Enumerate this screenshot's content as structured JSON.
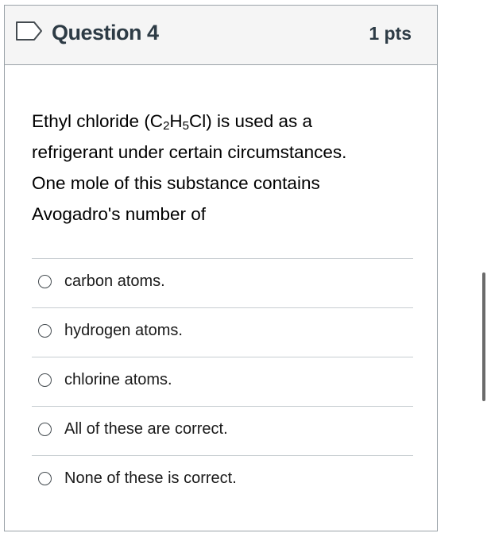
{
  "header": {
    "title": "Question 4",
    "points": "1 pts",
    "flag_icon": "flag-outline-icon"
  },
  "question": {
    "line1_pre": "Ethyl chloride (C",
    "sub1": "2",
    "mid1": "H",
    "sub2": "5",
    "line1_post": "Cl) is used as a",
    "line2": "refrigerant under certain circumstances.",
    "line3": "One mole of this substance contains",
    "line4": "Avogadro's number of"
  },
  "answers": [
    {
      "label": "carbon atoms.",
      "selected": false
    },
    {
      "label": "hydrogen atoms.",
      "selected": false
    },
    {
      "label": "chlorine atoms.",
      "selected": false
    },
    {
      "label": "All of these are correct.",
      "selected": false
    },
    {
      "label": "None of these is correct.",
      "selected": false
    }
  ],
  "colors": {
    "header_bg": "#f5f5f5",
    "border": "#9aa2a8",
    "divider": "#c7cdd1",
    "text": "#2d3b45"
  }
}
